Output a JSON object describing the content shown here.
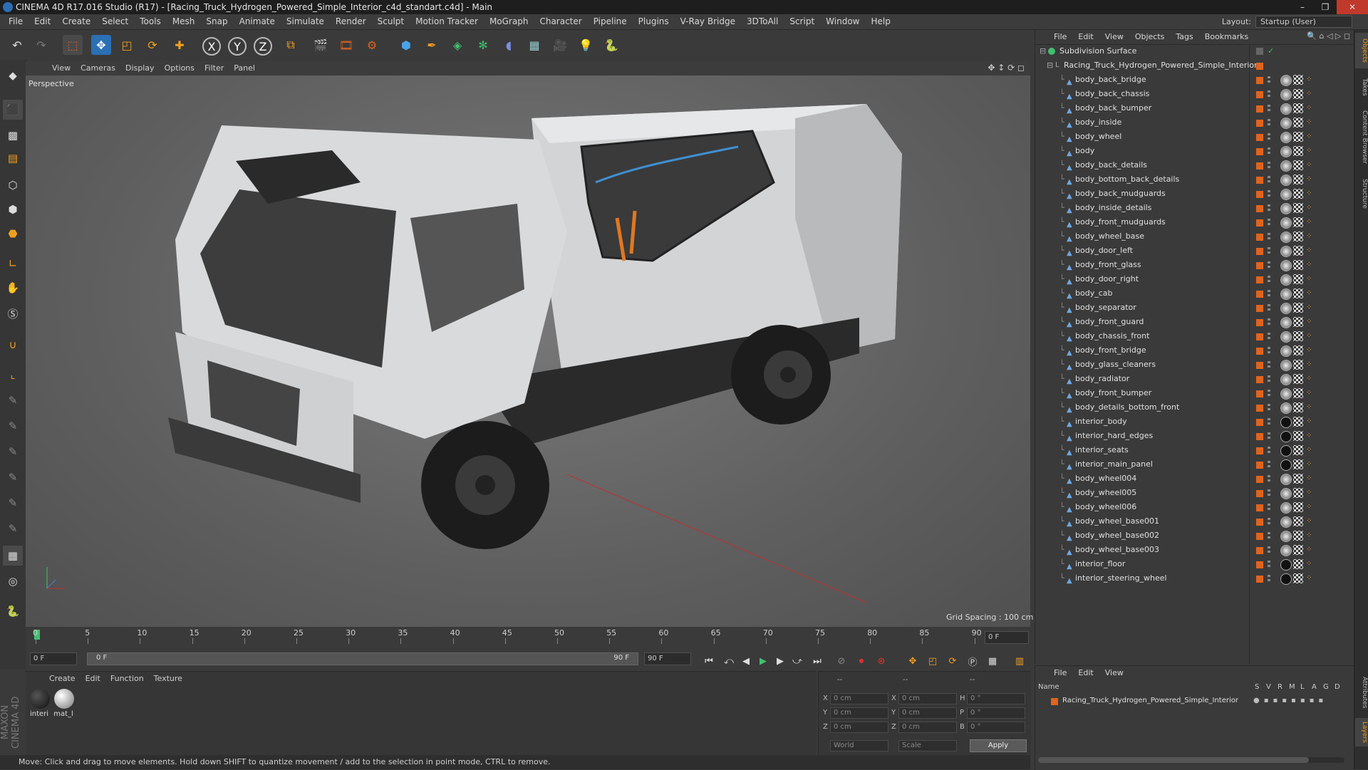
{
  "window": {
    "title": "CINEMA 4D R17.016 Studio (R17) - [Racing_Truck_Hydrogen_Powered_Simple_Interior_c4d_standart.c4d] - Main",
    "controls": [
      "–",
      "❐",
      "✕"
    ]
  },
  "menubar": {
    "items": [
      "File",
      "Edit",
      "Create",
      "Select",
      "Tools",
      "Mesh",
      "Snap",
      "Animate",
      "Simulate",
      "Render",
      "Sculpt",
      "Motion Tracker",
      "MoGraph",
      "Character",
      "Pipeline",
      "Plugins",
      "V-Ray Bridge",
      "3DToAll",
      "Script",
      "Window",
      "Help"
    ],
    "layout_label": "Layout:",
    "layout_value": "Startup (User)"
  },
  "toolbar": {
    "icons": [
      "undo-icon",
      "redo-icon",
      "live-select-icon",
      "move-icon",
      "scale-icon",
      "rotate-icon",
      "last-tool-icon",
      "x-axis-icon",
      "y-axis-icon",
      "z-axis-icon",
      "coord-system-icon",
      "render-view-icon",
      "render-picture-viewer-icon",
      "edit-render-settings-icon",
      "cube-icon",
      "pen-icon",
      "subdivision-icon",
      "array-icon",
      "deformer-icon",
      "floor-icon",
      "camera-icon",
      "light-icon",
      "python-icon"
    ],
    "axis_labels": [
      "X",
      "Y",
      "Z"
    ]
  },
  "viewport": {
    "menu": [
      "View",
      "Cameras",
      "Display",
      "Options",
      "Filter",
      "Panel"
    ],
    "name": "Perspective",
    "grid_spacing": "Grid Spacing : 100 cm"
  },
  "timeline": {
    "ticks": [
      "0",
      "5",
      "10",
      "15",
      "20",
      "25",
      "30",
      "35",
      "40",
      "45",
      "50",
      "55",
      "60",
      "65",
      "70",
      "75",
      "80",
      "85",
      "90"
    ],
    "current_frame": "0 F",
    "start_frame": "0 F",
    "range_start": "0 F",
    "range_end": "90 F",
    "end_frame": "90 F"
  },
  "material_manager": {
    "menu": [
      "Create",
      "Edit",
      "Function",
      "Texture"
    ],
    "materials": [
      {
        "label": "interi",
        "color": "#1a1a1a"
      },
      {
        "label": "mat_l",
        "color": "#8a8a8a"
      }
    ]
  },
  "coordinates": {
    "header": [
      "--",
      "--",
      "--"
    ],
    "rows": [
      {
        "a": "X",
        "av": "0 cm",
        "b": "X",
        "bv": "0 cm",
        "c": "H",
        "cv": "0 °"
      },
      {
        "a": "Y",
        "av": "0 cm",
        "b": "Y",
        "bv": "0 cm",
        "c": "P",
        "cv": "0 °"
      },
      {
        "a": "Z",
        "av": "0 cm",
        "b": "Z",
        "bv": "0 cm",
        "c": "B",
        "cv": "0 °"
      }
    ],
    "world_select": "World",
    "scale_select": "Scale",
    "apply_label": "Apply"
  },
  "status": {
    "text": "Move: Click and drag to move elements. Hold down SHIFT to quantize movement / add to the selection in point mode, CTRL to remove."
  },
  "object_manager": {
    "menu": [
      "File",
      "Edit",
      "View",
      "Objects",
      "Tags",
      "Bookmarks"
    ],
    "root": "Subdivision Surface",
    "group": "Racing_Truck_Hydrogen_Powered_Simple_Interior",
    "objects": [
      {
        "name": "body_back_bridge",
        "mat": "checker"
      },
      {
        "name": "body_back_chassis",
        "mat": "checker"
      },
      {
        "name": "body_back_bumper",
        "mat": "checker"
      },
      {
        "name": "body_inside",
        "mat": "checker"
      },
      {
        "name": "body_wheel",
        "mat": "checker"
      },
      {
        "name": "body",
        "mat": "checker"
      },
      {
        "name": "body_back_details",
        "mat": "checker"
      },
      {
        "name": "body_bottom_back_details",
        "mat": "checker"
      },
      {
        "name": "body_back_mudguards",
        "mat": "checker"
      },
      {
        "name": "body_inside_details",
        "mat": "checker"
      },
      {
        "name": "body_front_mudguards",
        "mat": "checker"
      },
      {
        "name": "body_wheel_base",
        "mat": "checker"
      },
      {
        "name": "body_door_left",
        "mat": "checker"
      },
      {
        "name": "body_front_glass",
        "mat": "checker"
      },
      {
        "name": "body_door_right",
        "mat": "checker"
      },
      {
        "name": "body_cab",
        "mat": "checker"
      },
      {
        "name": "body_separator",
        "mat": "checker"
      },
      {
        "name": "body_front_guard",
        "mat": "checker"
      },
      {
        "name": "body_chassis_front",
        "mat": "checker"
      },
      {
        "name": "body_front_bridge",
        "mat": "checker"
      },
      {
        "name": "body_glass_cleaners",
        "mat": "checker"
      },
      {
        "name": "body_radiator",
        "mat": "checker"
      },
      {
        "name": "body_front_bumper",
        "mat": "checker"
      },
      {
        "name": "body_details_bottom_front",
        "mat": "checker"
      },
      {
        "name": "interior_body",
        "mat": "dark"
      },
      {
        "name": "interior_hard_edges",
        "mat": "dark"
      },
      {
        "name": "interior_seats",
        "mat": "dark"
      },
      {
        "name": "interior_main_panel",
        "mat": "dark"
      },
      {
        "name": "body_wheel004",
        "mat": "checker"
      },
      {
        "name": "body_wheel005",
        "mat": "checker"
      },
      {
        "name": "body_wheel006",
        "mat": "checker"
      },
      {
        "name": "body_wheel_base001",
        "mat": "checker"
      },
      {
        "name": "body_wheel_base002",
        "mat": "checker"
      },
      {
        "name": "body_wheel_base003",
        "mat": "checker"
      },
      {
        "name": "interior_floor",
        "mat": "dark"
      },
      {
        "name": "interior_steering_wheel",
        "mat": "dark"
      }
    ]
  },
  "layer_manager": {
    "menu": [
      "File",
      "Edit",
      "View"
    ],
    "columns": [
      "Name",
      "S",
      "V",
      "R",
      "M",
      "L",
      "A",
      "G",
      "D"
    ],
    "layer": "Racing_Truck_Hydrogen_Powered_Simple_Interior"
  },
  "right_tabs": [
    "Objects",
    "Takes",
    "Content Browser",
    "Structure",
    "Attributes",
    "Layers"
  ],
  "colors": {
    "accent_orange": "#e0641e",
    "selection_blue": "#2b6fb5",
    "truck_white": "#d9dadb",
    "tire_black": "#1c1c1c"
  }
}
